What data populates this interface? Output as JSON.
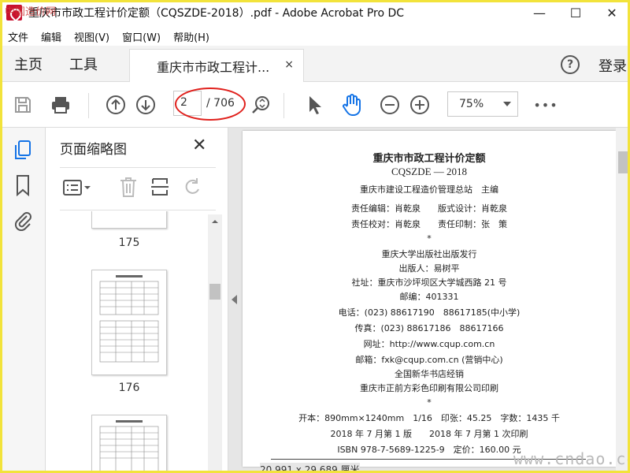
{
  "window": {
    "title": "重庆市市政工程计价定额（CQSZDE-2018）.pdf - Adobe Acrobat Pro DC",
    "minimize": "—",
    "maximize": "☐",
    "close": "✕"
  },
  "menu": [
    "文件",
    "编辑",
    "视图(V)",
    "窗口(W)",
    "帮助(H)"
  ],
  "tabs": {
    "home": "主页",
    "tools": "工具",
    "document": "重庆市市政工程计...",
    "close": "×",
    "help": "?",
    "login": "登录"
  },
  "toolbar": {
    "current_page": "2",
    "total_pages": "/ 706",
    "zoom": "75%",
    "more": "•••"
  },
  "thumbnails": {
    "title": "页面缩略图",
    "close": "✕",
    "pages": [
      "175",
      "176"
    ]
  },
  "document": {
    "lines": [
      "重庆市市政工程计价定额",
      "CQSZDE — 2018",
      "重庆市建设工程造价管理总站　主编",
      "责任编辑：肖乾泉　　版式设计：肖乾泉",
      "责任校对：肖乾泉　　责任印制：张　策",
      "*",
      "重庆大学出版社出版发行",
      "出版人：易树平",
      "社址：重庆市沙坪坝区大学城西路 21 号",
      "邮编：401331",
      "电话：(023) 88617190　88617185(中小学)",
      "传真：(023) 88617186　88617166",
      "网址：http://www.cqup.com.cn",
      "邮箱：fxk@cqup.com.cn (营销中心)",
      "全国新华书店经销",
      "重庆市正前方彩色印刷有限公司印刷",
      "*",
      "开本：890mm×1240mm　1/16　印张：45.25　字数：1435 千",
      "2018 年 7 月第 1 版　　2018 年 7 月第 1 次印刷",
      "ISBN 978-7-5689-1225-9　定价：160.00 元"
    ]
  },
  "status": {
    "page_size": "20.991 x 29.689 厘米"
  },
  "watermark": "www.cndao.com",
  "corner_logo": "中国造价网"
}
